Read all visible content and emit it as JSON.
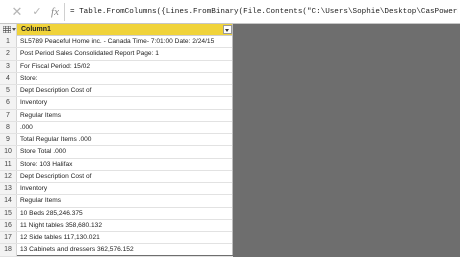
{
  "formula_bar": {
    "cancel_icon": "✕",
    "accept_icon": "✓",
    "fx_label": "fx",
    "formula": "= Table.FromColumns({Lines.FromBinary(File.Contents(\"C:\\Users\\Sophie\\Desktop\\CasPowerBI\\Fichiers"
  },
  "grid": {
    "column_header": "Column1",
    "rows": [
      {
        "num": "1",
        "value": "SL5789 Peaceful Home inc. - Canada Time- 7:01:00 Date: 2/24/15"
      },
      {
        "num": "2",
        "value": "Post Period Sales Consolidated Report Page: 1"
      },
      {
        "num": "3",
        "value": "For Fiscal Period: 15/02"
      },
      {
        "num": "4",
        "value": "Store:"
      },
      {
        "num": "5",
        "value": "Dept Description Cost of"
      },
      {
        "num": "6",
        "value": "Inventory"
      },
      {
        "num": "7",
        "value": "Regular Items"
      },
      {
        "num": "8",
        "value": ".000"
      },
      {
        "num": "9",
        "value": "Total Regular Items .000"
      },
      {
        "num": "10",
        "value": "Store Total .000"
      },
      {
        "num": "11",
        "value": "Store: 103 Halifax"
      },
      {
        "num": "12",
        "value": "Dept Description Cost of"
      },
      {
        "num": "13",
        "value": "Inventory"
      },
      {
        "num": "14",
        "value": "Regular Items"
      },
      {
        "num": "15",
        "value": "10 Beds 285,246.375"
      },
      {
        "num": "16",
        "value": "11 Night tables 358,680.132"
      },
      {
        "num": "17",
        "value": "12 Side tables 117,130.021"
      },
      {
        "num": "18",
        "value": "13 Cabinets and dressers 362,576.152"
      }
    ]
  },
  "colors": {
    "header_yellow": "#f0d33a",
    "canvas_gray": "#6e6e6e"
  }
}
